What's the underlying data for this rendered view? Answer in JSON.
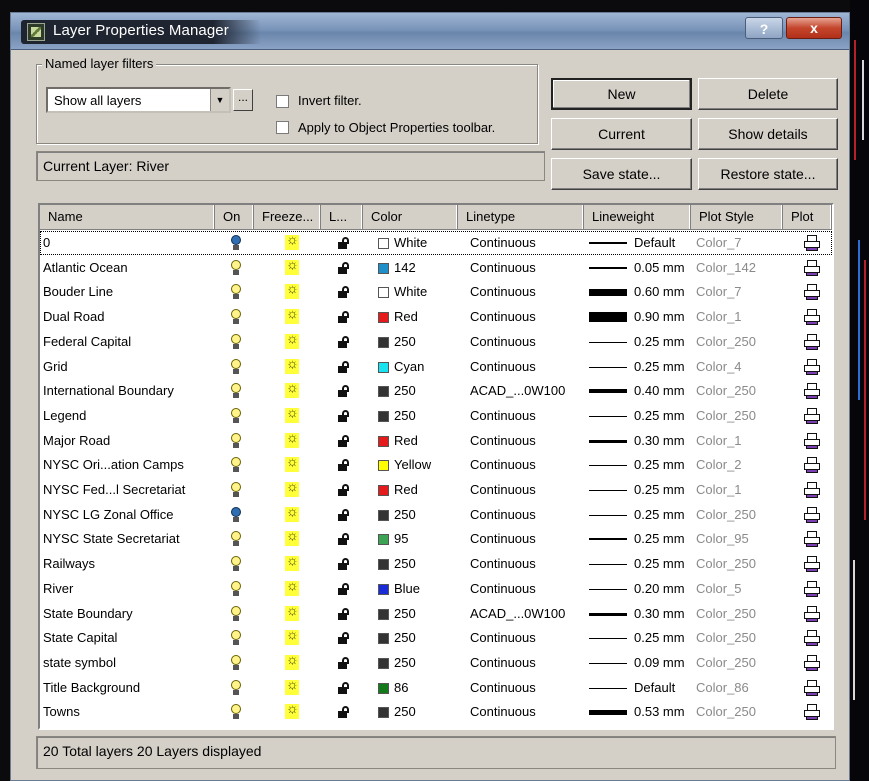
{
  "window": {
    "title": "Layer Properties Manager",
    "help_label": "?",
    "close_label": "x"
  },
  "filters": {
    "group_label": "Named layer filters",
    "selected": "Show all layers",
    "more_label": "...",
    "invert_label": "Invert filter.",
    "invert_checked": false,
    "apply_label": "Apply to Object Properties toolbar.",
    "apply_checked": false
  },
  "buttons": {
    "new": "New",
    "delete": "Delete",
    "current": "Current",
    "show_details": "Show details",
    "save_state": "Save state...",
    "restore_state": "Restore state..."
  },
  "current_layer": "Current Layer:  River",
  "columns": [
    "Name",
    "On",
    "Freeze...",
    "L...",
    "Color",
    "Linetype",
    "Lineweight",
    "Plot Style",
    "Plot"
  ],
  "layers": [
    {
      "name": "0",
      "on": true,
      "on_color": "blue",
      "color_name": "White",
      "swatch": "#ffffff",
      "linetype": "Continuous",
      "lw": "Default",
      "lw_thick": 2,
      "plot_style": "Color_7"
    },
    {
      "name": "Atlantic Ocean",
      "on": true,
      "on_color": "yellow",
      "color_name": "142",
      "swatch": "#1e8fc8",
      "linetype": "Continuous",
      "lw": "0.05 mm",
      "lw_thick": 2,
      "plot_style": "Color_142"
    },
    {
      "name": "Bouder Line",
      "on": true,
      "on_color": "yellow",
      "color_name": "White",
      "swatch": "#ffffff",
      "linetype": "Continuous",
      "lw": "0.60 mm",
      "lw_thick": 7,
      "plot_style": "Color_7"
    },
    {
      "name": "Dual Road",
      "on": true,
      "on_color": "yellow",
      "color_name": "Red",
      "swatch": "#e51a1a",
      "linetype": "Continuous",
      "lw": "0.90 mm",
      "lw_thick": 10,
      "plot_style": "Color_1"
    },
    {
      "name": "Federal Capital",
      "on": true,
      "on_color": "yellow",
      "color_name": "250",
      "swatch": "#333333",
      "linetype": "Continuous",
      "lw": "0.25 mm",
      "lw_thick": 1,
      "plot_style": "Color_250"
    },
    {
      "name": "Grid",
      "on": true,
      "on_color": "yellow",
      "color_name": "Cyan",
      "swatch": "#19e3f0",
      "linetype": "Continuous",
      "lw": "0.25 mm",
      "lw_thick": 1,
      "plot_style": "Color_4"
    },
    {
      "name": "International Boundary",
      "on": true,
      "on_color": "yellow",
      "color_name": "250",
      "swatch": "#333333",
      "linetype": "ACAD_...0W100",
      "lw": "0.40 mm",
      "lw_thick": 4,
      "plot_style": "Color_250"
    },
    {
      "name": "Legend",
      "on": true,
      "on_color": "yellow",
      "color_name": "250",
      "swatch": "#333333",
      "linetype": "Continuous",
      "lw": "0.25 mm",
      "lw_thick": 1,
      "plot_style": "Color_250"
    },
    {
      "name": "Major Road",
      "on": true,
      "on_color": "yellow",
      "color_name": "Red",
      "swatch": "#e51a1a",
      "linetype": "Continuous",
      "lw": "0.30 mm",
      "lw_thick": 3,
      "plot_style": "Color_1"
    },
    {
      "name": "NYSC  Ori...ation Camps",
      "on": true,
      "on_color": "yellow",
      "color_name": "Yellow",
      "swatch": "#ffff00",
      "linetype": "Continuous",
      "lw": "0.25 mm",
      "lw_thick": 1,
      "plot_style": "Color_2"
    },
    {
      "name": "NYSC Fed...l Secretariat",
      "on": true,
      "on_color": "yellow",
      "color_name": "Red",
      "swatch": "#e51a1a",
      "linetype": "Continuous",
      "lw": "0.25 mm",
      "lw_thick": 1,
      "plot_style": "Color_1"
    },
    {
      "name": "NYSC LG Zonal Office",
      "on": true,
      "on_color": "blue",
      "color_name": "250",
      "swatch": "#333333",
      "linetype": "Continuous",
      "lw": "0.25 mm",
      "lw_thick": 1,
      "plot_style": "Color_250"
    },
    {
      "name": "NYSC State Secretariat",
      "on": true,
      "on_color": "yellow",
      "color_name": "95",
      "swatch": "#3aa454",
      "linetype": "Continuous",
      "lw": "0.25 mm",
      "lw_thick": 2,
      "plot_style": "Color_95"
    },
    {
      "name": "Railways",
      "on": true,
      "on_color": "yellow",
      "color_name": "250",
      "swatch": "#333333",
      "linetype": "Continuous",
      "lw": "0.25 mm",
      "lw_thick": 1,
      "plot_style": "Color_250"
    },
    {
      "name": "River",
      "on": true,
      "on_color": "yellow",
      "color_name": "Blue",
      "swatch": "#1a2bd8",
      "linetype": "Continuous",
      "lw": "0.20 mm",
      "lw_thick": 1,
      "plot_style": "Color_5"
    },
    {
      "name": "State Boundary",
      "on": true,
      "on_color": "yellow",
      "color_name": "250",
      "swatch": "#333333",
      "linetype": "ACAD_...0W100",
      "lw": "0.30 mm",
      "lw_thick": 3,
      "plot_style": "Color_250"
    },
    {
      "name": "State Capital",
      "on": true,
      "on_color": "yellow",
      "color_name": "250",
      "swatch": "#333333",
      "linetype": "Continuous",
      "lw": "0.25 mm",
      "lw_thick": 1,
      "plot_style": "Color_250"
    },
    {
      "name": "state symbol",
      "on": true,
      "on_color": "yellow",
      "color_name": "250",
      "swatch": "#333333",
      "linetype": "Continuous",
      "lw": "0.09 mm",
      "lw_thick": 1,
      "plot_style": "Color_250"
    },
    {
      "name": "Title Background",
      "on": true,
      "on_color": "yellow",
      "color_name": "86",
      "swatch": "#137a1a",
      "linetype": "Continuous",
      "lw": "Default",
      "lw_thick": 1,
      "plot_style": "Color_86"
    },
    {
      "name": "Towns",
      "on": true,
      "on_color": "yellow",
      "color_name": "250",
      "swatch": "#333333",
      "linetype": "Continuous",
      "lw": "0.53 mm",
      "lw_thick": 5,
      "plot_style": "Color_250"
    }
  ],
  "status": "20 Total layers    20 Layers displayed"
}
